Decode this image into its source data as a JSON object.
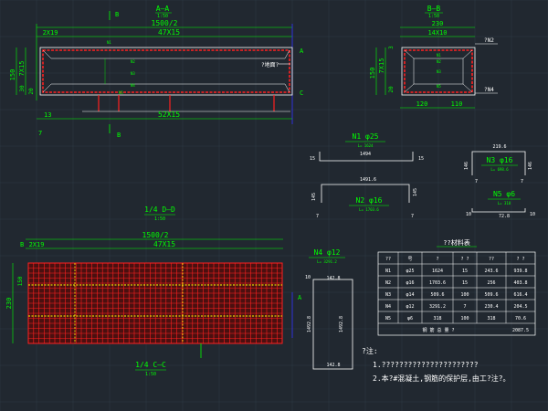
{
  "colors": {
    "background": "#212830",
    "grid": "#2f3a45",
    "dimension": "#00ff00",
    "rebar": "#ff2020",
    "outline": "#ffffff",
    "stirrup": "#ffff00",
    "note": "#ffffff",
    "axis": "#3333ff"
  },
  "section_aa": {
    "title": "A—A",
    "scale": "1:50",
    "cut_label_b": "B",
    "top_total": "1500/2",
    "top_left": "2X19",
    "top_mid": "47X15",
    "left_dims": [
      "150",
      "7X15",
      "30",
      "20"
    ],
    "bottom_left": "13",
    "bottom_mid": "52X15",
    "bottom_7": "7",
    "bar_labels": [
      "N1",
      "N2",
      "N3",
      "N4",
      "N5"
    ],
    "note_arrow": "?地面?"
  },
  "section_bb": {
    "title": "B—B",
    "scale": "1:50",
    "top_total": "230",
    "top_mid": "14X10",
    "left_dims": [
      "150",
      "7X15",
      "20",
      "3"
    ],
    "bottom_dims": [
      "120",
      "110"
    ],
    "bar_labels": [
      "N1",
      "N2",
      "N3",
      "N5"
    ],
    "note_top": "?N2",
    "note_bottom": "?N4"
  },
  "section_cc_top": {
    "title": "1/4 D—D",
    "scale": "1:50",
    "top_total": "1500/2",
    "top_left": "2X19",
    "top_mid": "47X15",
    "left_dims": [
      "150",
      "230"
    ],
    "cut_label_a": "A",
    "cut_label_b": "B"
  },
  "section_cc_bottom": {
    "title": "1/4 C—C",
    "scale": "1:50"
  },
  "bars": {
    "n1": {
      "title": "N1 φ25",
      "length": "L= 1624",
      "dim": "1494",
      "left": "15",
      "right": "15"
    },
    "n2": {
      "title": "N2 φ16",
      "length": "L= 1703.6",
      "dim": "1491.6",
      "left": "145",
      "right": "145",
      "end_left": "7",
      "end_right": "7"
    },
    "n3": {
      "title": "N3 φ16",
      "length": "L= 698.6",
      "dim": "219.6",
      "left": "146",
      "right": "146",
      "end_left": "7",
      "end_right": "7"
    },
    "n4": {
      "title": "N4 φ12",
      "length": "L= 3291.2",
      "top": "142.8",
      "bottom": "142.8",
      "left": "1492.8",
      "right": "1492.8",
      "top_left": "10"
    },
    "n5": {
      "title": "N5 φ6",
      "length": "L= 318",
      "dim": "72.8",
      "left": "10",
      "right": "10"
    }
  },
  "table": {
    "title": "??材料表",
    "headers": [
      "??",
      "号",
      "?",
      "? ?",
      "??",
      "? ?"
    ],
    "rows": [
      [
        "N1",
        "φ25",
        "1624",
        "15",
        "243.6",
        "939.8"
      ],
      [
        "N2",
        "φ16",
        "1703.6",
        "15",
        "256",
        "403.8"
      ],
      [
        "N3",
        "φ14",
        "509.6",
        "100",
        "509.6",
        "616.4"
      ],
      [
        "N4",
        "φ12",
        "3291.2",
        "7",
        "230.4",
        "204.5"
      ],
      [
        "N5",
        "φ6",
        "318",
        "100",
        "318",
        "70.6"
      ]
    ],
    "footer": "钢 筋 总 量 ?",
    "footer_total": "2087.5"
  },
  "notes": {
    "title": "?注:",
    "line1": "1.??????????????????????",
    "line2": "2.本?#混凝土,钢筋的保护层,由工?注?。"
  }
}
